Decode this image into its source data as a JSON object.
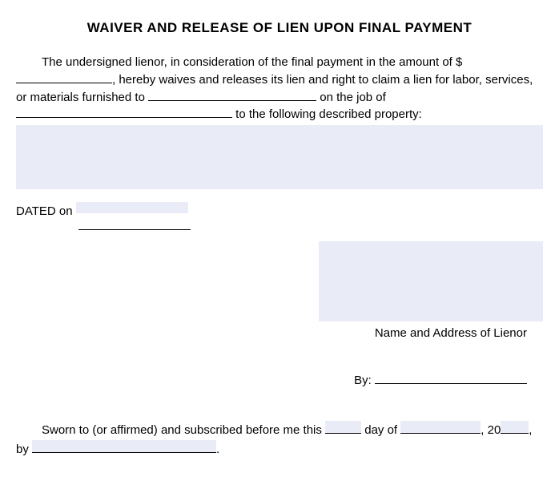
{
  "title": "WAIVER AND RELEASE OF LIEN UPON FINAL PAYMENT",
  "paragraph": {
    "part1": "The undersigned lienor, in consideration of the final payment in the amount of $",
    "part2": ", hereby waives and releases its lien and right to claim a lien for labor, services, or materials furnished to ",
    "part3": " on the job of ",
    "part4": " to the following described property:"
  },
  "dated": {
    "label": "DATED on "
  },
  "lienor": {
    "label": "Name and Address of Lienor",
    "by": "By: "
  },
  "sworn": {
    "part1": "Sworn to (or affirmed) and subscribed before me this ",
    "part2": " day of ",
    "part3": ", 20",
    "part4": ", by ",
    "part5": "."
  }
}
